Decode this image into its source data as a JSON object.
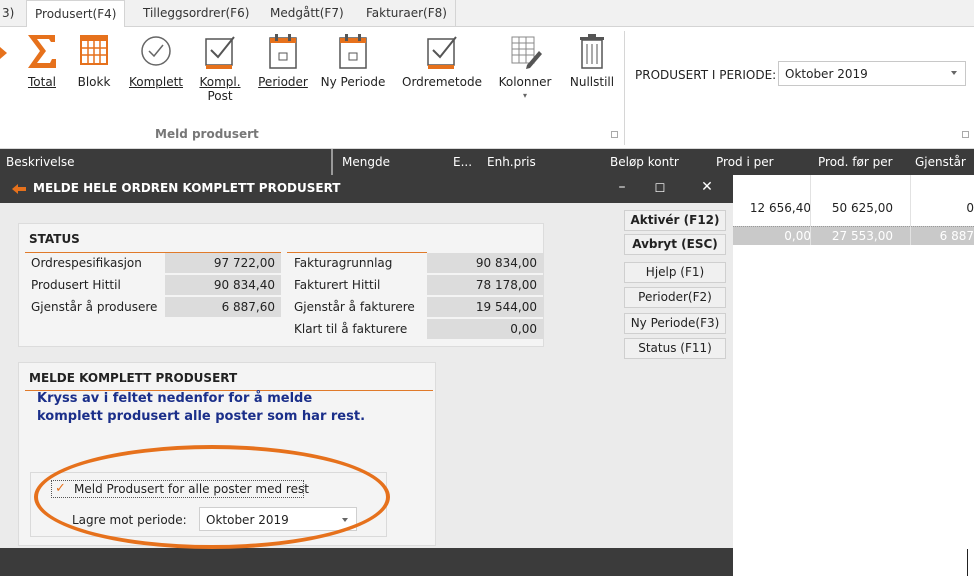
{
  "tabs": [
    {
      "label": "3)"
    },
    {
      "label": "Produsert(F4)"
    },
    {
      "label": "Tilleggsordrer(F6)"
    },
    {
      "label": "Medgått(F7)"
    },
    {
      "label": "Fakturaer(F8)"
    }
  ],
  "ribbon": {
    "buttons": [
      {
        "label": "Total",
        "icon": "sigma-icon"
      },
      {
        "label": "Blokk",
        "icon": "grid-block-icon"
      },
      {
        "label": "Komplett",
        "icon": "check-circle-icon"
      },
      {
        "label": "Kompl.",
        "label2": "Post",
        "icon": "check-box-icon"
      },
      {
        "label": "Perioder",
        "icon": "calendar-icon"
      },
      {
        "label": "Ny Periode",
        "icon": "calendar-new-icon"
      },
      {
        "label": "Ordremetode",
        "icon": "check-box-icon"
      },
      {
        "label": "Kolonner",
        "icon": "columns-edit-icon"
      },
      {
        "label": "Nullstill",
        "icon": "trash-icon"
      }
    ],
    "group_label": "Meld produsert",
    "period_label": "PRODUSERT I PERIODE:",
    "period_value": "Oktober 2019"
  },
  "grid": {
    "headers": [
      "Beskrivelse",
      "Mengde",
      "E...",
      "Enh.pris",
      "Beløp kontr",
      "Prod i per",
      "Prod. før per",
      "Gjenstår"
    ],
    "rows": [
      {
        "prod_i_per": "12 656,40",
        "prod_for_per": "50 625,00",
        "gjenstar": "0"
      },
      {
        "prod_i_per": "0,00",
        "prod_for_per": "27 553,00",
        "gjenstar": "6 887"
      }
    ]
  },
  "dialog": {
    "title": "MELDE HELE ORDREN KOMPLETT PRODUSERT",
    "status": {
      "heading": "STATUS",
      "left": [
        {
          "label": "Ordrespesifikasjon",
          "value": "97 722,00"
        },
        {
          "label": "Produsert Hittil",
          "value": "90 834,40"
        },
        {
          "label": "Gjenstår å produsere",
          "value": "6 887,60"
        }
      ],
      "right": [
        {
          "label": "Fakturagrunnlag",
          "value": "90 834,00"
        },
        {
          "label": "Fakturert Hittil",
          "value": "78 178,00"
        },
        {
          "label": "Gjenstår å fakturere",
          "value": "19 544,00"
        },
        {
          "label": "Klart til å fakturere",
          "value": "0,00"
        }
      ]
    },
    "complete": {
      "heading": "MELDE KOMPLETT PRODUSERT",
      "instruction_line1": "Kryss av i feltet nedenfor for å melde",
      "instruction_line2": "komplett produsert alle poster som har rest.",
      "checkbox_label": "Meld Produsert for alle poster med rest",
      "checkbox_checked": true,
      "period_label": "Lagre mot periode:",
      "period_value": "Oktober 2019"
    },
    "buttons": [
      {
        "label": "Aktivér (F12)"
      },
      {
        "label": "Avbryt (ESC)"
      },
      {
        "label": "Hjelp (F1)"
      },
      {
        "label": "Perioder(F2)"
      },
      {
        "label": "Ny Periode(F3)"
      },
      {
        "label": "Status (F11)"
      }
    ]
  },
  "colors": {
    "accent": "#e6711c",
    "dark": "#3b3b3b",
    "instruction": "#1b2f8a"
  }
}
